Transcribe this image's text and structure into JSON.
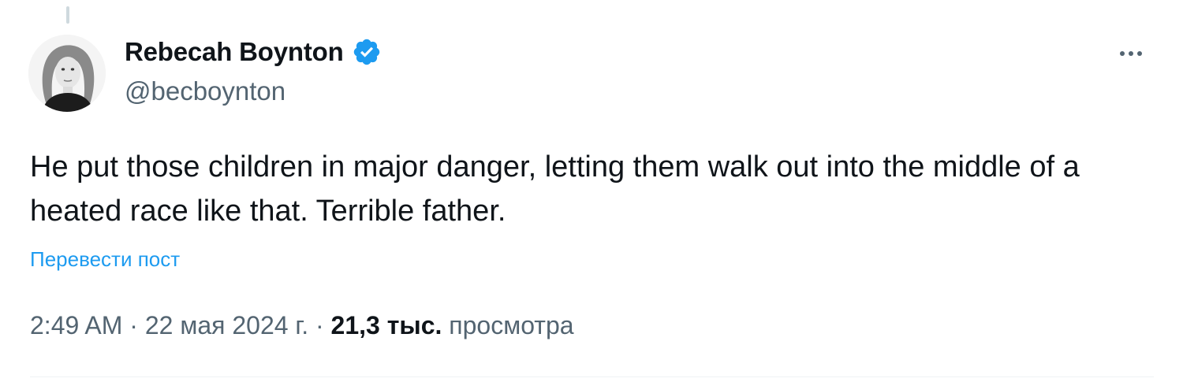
{
  "author": {
    "display_name": "Rebecah Boynton",
    "handle": "@becboynton",
    "verified": true,
    "verified_color": "#1d9bf0"
  },
  "tweet": {
    "text": "He put those children in major danger, letting them walk out into the middle of a heated race like that. Terrible father.",
    "translate_label": "Перевести пост",
    "time": "2:49 AM",
    "separator": " · ",
    "date": "22 мая 2024 г.",
    "views_count": "21,3 тыс.",
    "views_label": "просмотра"
  },
  "icons": {
    "more": "more-horizontal-icon",
    "verified": "verified-badge-icon"
  },
  "colors": {
    "accent": "#1d9bf0",
    "text_primary": "#0f1419",
    "text_secondary": "#536471"
  }
}
